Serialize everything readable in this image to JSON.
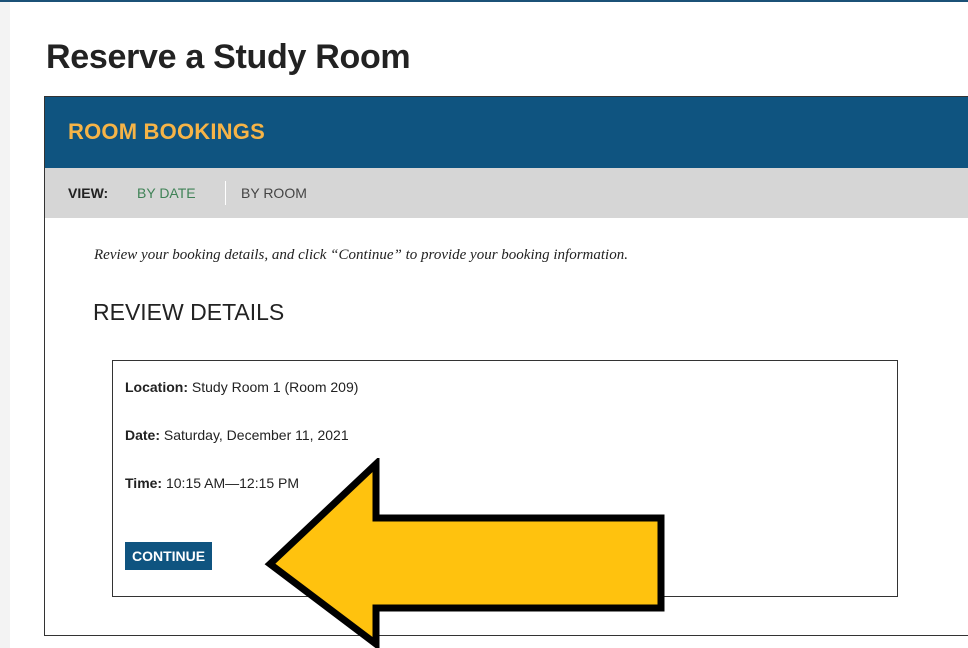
{
  "page": {
    "title": "Reserve a Study Room"
  },
  "panel": {
    "title": "ROOM BOOKINGS",
    "view_label": "VIEW:",
    "view_options": [
      {
        "label": "BY DATE",
        "active": true
      },
      {
        "label": "BY ROOM",
        "active": false
      }
    ]
  },
  "instructions": "Review your booking details, and click “Continue” to provide your booking information.",
  "review": {
    "heading": "REVIEW DETAILS",
    "location_label": "Location:",
    "location_value": " Study Room 1 (Room 209)",
    "date_label": "Date:",
    "date_value": " Saturday, December 11, 2021",
    "time_label": "Time:",
    "time_value": " 10:15 AM—12:15 PM",
    "continue_label": "CONTINUE"
  },
  "annotation": {
    "arrow_icon": "left-arrow-icon",
    "arrow_color": "#ffc20e"
  },
  "colors": {
    "header_blue": "#0f5480",
    "header_title_orange": "#f6b447",
    "active_view_green": "#3f8256",
    "view_bar_gray": "#d6d6d6"
  }
}
